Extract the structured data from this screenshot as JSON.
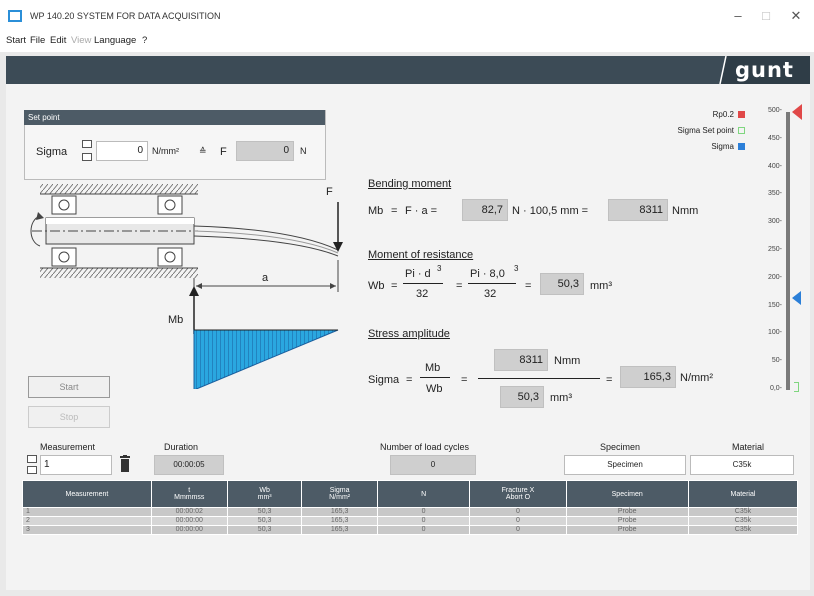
{
  "window": {
    "title": "WP 140.20 SYSTEM FOR DATA ACQUISITION",
    "minimize": "–",
    "maximize": "□",
    "close": "✕"
  },
  "menu": [
    "Start",
    "File",
    "Edit",
    "View",
    "Language",
    "?"
  ],
  "brand": "gunt",
  "set_point": {
    "header": "Set point",
    "sigma_label": "Sigma",
    "sigma_value": "0",
    "sigma_unit": "N/mm²",
    "equiv": "≙",
    "f_label": "F",
    "f_value": "0",
    "f_unit": "N"
  },
  "diagram": {
    "force_label": "F",
    "distance_label": "a",
    "moment_label": "Mb"
  },
  "bending": {
    "title": "Bending moment",
    "lhs": "Mb",
    "eq": "=",
    "expr": "F · a =",
    "f_value": "82,7",
    "mid": "N · 100,5 mm  =",
    "result": "8311",
    "unit": "Nmm"
  },
  "resistance": {
    "title": "Moment of resistance",
    "lhs": "Wb",
    "frac1_num": "Pi · d",
    "frac1_exp": "3",
    "frac1_den": "32",
    "frac2_num": "Pi · 8,0",
    "frac2_exp": "3",
    "frac2_den": "32",
    "result": "50,3",
    "unit": "mm³"
  },
  "stress": {
    "title": "Stress amplitude",
    "lhs": "Sigma",
    "frac_num": "Mb",
    "frac_den": "Wb",
    "mb_value": "8311",
    "mb_unit": "Nmm",
    "wb_value": "50,3",
    "wb_unit": "mm³",
    "result": "165,3",
    "unit": "N/mm²"
  },
  "legend": {
    "rp02": "Rp0.2",
    "sigma_set": "Sigma Set point",
    "sigma": "Sigma",
    "rp02_color": "#e04848",
    "set_color": "#7fd67f",
    "sigma_color": "#2b7fd8"
  },
  "gauge": {
    "ticks": [
      "500-",
      "450-",
      "400-",
      "350-",
      "300-",
      "250-",
      "200-",
      "150-",
      "100-",
      "50-",
      "0,0-"
    ],
    "min": 0,
    "max": 500,
    "rp02_marker": 500,
    "sigma_marker": 165.3,
    "setpoint_marker": 0
  },
  "buttons": {
    "start": "Start",
    "stop": "Stop"
  },
  "status": {
    "measurement_label": "Measurement",
    "measurement_value": "1",
    "duration_label": "Duration",
    "duration_value": "00:00:05",
    "cycles_label": "Number of load cycles",
    "cycles_value": "0",
    "specimen_label": "Specimen",
    "specimen_value": "Specimen",
    "material_label": "Material",
    "material_value": "C35k"
  },
  "table": {
    "headers": [
      [
        "Measurement"
      ],
      [
        "t",
        "Mmmmss"
      ],
      [
        "Wb",
        "mm³"
      ],
      [
        "Sigma",
        "N/mm²"
      ],
      [
        "N"
      ],
      [
        "Fracture X",
        "Abort O"
      ],
      [
        "Specimen"
      ],
      [
        "Material"
      ]
    ],
    "rows": [
      [
        "1",
        "00:00:02",
        "50,3",
        "165,3",
        "0",
        "0",
        "Probe",
        "C35k"
      ],
      [
        "2",
        "00:00:00",
        "50,3",
        "165,3",
        "0",
        "0",
        "Probe",
        "C35k"
      ],
      [
        "3",
        "00:00:00",
        "50,3",
        "165,3",
        "0",
        "0",
        "Probe",
        "C35k"
      ]
    ]
  }
}
